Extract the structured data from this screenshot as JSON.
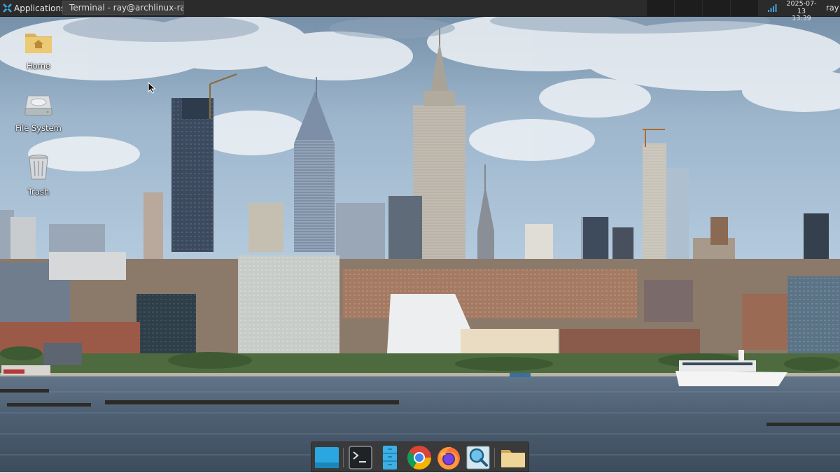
{
  "top_panel": {
    "applications_label": "Applications",
    "task_terminal_label": "Terminal - ray@archlinux-ra...",
    "clock_date": "2025-07-13",
    "clock_time": "13:39",
    "user": "ray"
  },
  "desktop": {
    "icons": [
      {
        "label": "Home",
        "icon": "home-folder-icon"
      },
      {
        "label": "File System",
        "icon": "hard-drive-icon"
      },
      {
        "label": "Trash",
        "icon": "trash-icon"
      }
    ]
  },
  "dock": {
    "items": [
      {
        "icon": "show-desktop-icon"
      },
      {
        "icon": "terminal-icon"
      },
      {
        "icon": "file-manager-icon"
      },
      {
        "icon": "chrome-icon"
      },
      {
        "icon": "firefox-icon"
      },
      {
        "icon": "app-finder-icon"
      },
      {
        "icon": "folder-icon"
      }
    ]
  },
  "colors": {
    "panel": "#2b2b2b",
    "sky": "#a9c4dc",
    "water": "#4a5a6c",
    "dock": "#3a3a3a"
  }
}
